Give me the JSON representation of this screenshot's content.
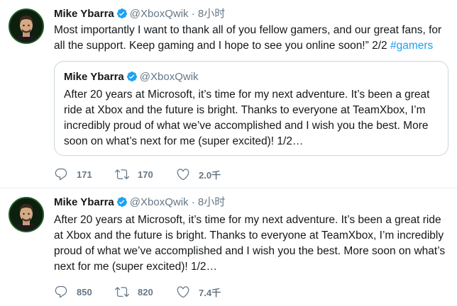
{
  "tweets": [
    {
      "author_name": "Mike Ybarra",
      "handle": "@XboxQwik",
      "separator": "·",
      "time": "8小时",
      "text_main": "Most importantly I want to thank all of you fellow gamers, and our great fans, for all the support. Keep gaming and I hope to see you online soon!” 2/2 ",
      "hashtag": "#gamers",
      "quote": {
        "author_name": "Mike Ybarra",
        "handle": "@XboxQwik",
        "text": "After 20 years at Microsoft, it’s time for my next adventure. It’s been a great ride at Xbox and the future is bright. Thanks to everyone at TeamXbox, I’m incredibly proud of what we’ve accomplished and I wish you the best. More soon on what’s next for me (super excited)! 1/2…"
      },
      "replies": "171",
      "retweets": "170",
      "likes": "2.0千"
    },
    {
      "author_name": "Mike Ybarra",
      "handle": "@XboxQwik",
      "separator": "·",
      "time": "8小时",
      "text_main": "After 20 years at Microsoft, it’s time for my next adventure. It’s been a great ride at Xbox and the future is bright. Thanks to everyone at TeamXbox, I’m incredibly proud of what we’ve accomplished and I wish you the best. More soon on what’s next for me (super excited)! 1/2…",
      "replies": "850",
      "retweets": "820",
      "likes": "7.4千"
    }
  ],
  "colors": {
    "link": "#1da1f2",
    "muted": "#657786",
    "verified": "#1da1f2",
    "border": "#ccd6dd"
  }
}
